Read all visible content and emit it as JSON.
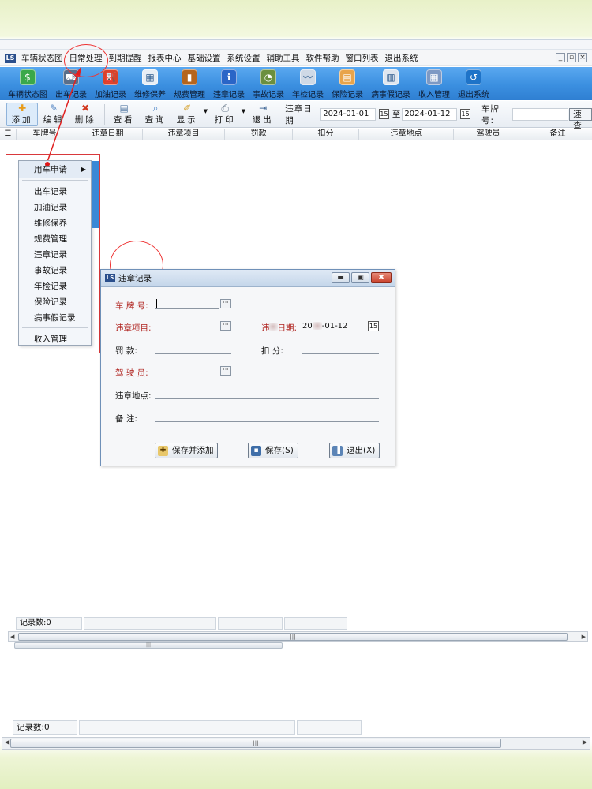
{
  "menubar": {
    "items": [
      "车辆状态图",
      "日常处理",
      "到期提醒",
      "报表中心",
      "基础设置",
      "系统设置",
      "辅助工具",
      "软件帮助",
      "窗口列表",
      "退出系统"
    ],
    "window_buttons": [
      "_",
      "▫",
      "×"
    ]
  },
  "toolbar_main": {
    "items": [
      {
        "label": "车辆状态图",
        "icon": "vehicle-status-icon",
        "color": "#3aa84a"
      },
      {
        "label": "出车记录",
        "icon": "dispatch-icon",
        "color": "#5a6f8a"
      },
      {
        "label": "加油记录",
        "icon": "fuel-icon",
        "color": "#d9422b"
      },
      {
        "label": "维修保养",
        "icon": "repair-icon",
        "color": "#e8eef5"
      },
      {
        "label": "规费管理",
        "icon": "fee-icon",
        "color": "#b5651d"
      },
      {
        "label": "违章记录",
        "icon": "violation-icon",
        "color": "#2a65c7"
      },
      {
        "label": "事故记录",
        "icon": "accident-icon",
        "color": "#6b8f3e"
      },
      {
        "label": "年检记录",
        "icon": "inspection-icon",
        "color": "#cfd9e6"
      },
      {
        "label": "保险记录",
        "icon": "insurance-icon",
        "color": "#e8a44a"
      },
      {
        "label": "病事假记录",
        "icon": "leave-icon",
        "color": "#dfe6ef"
      },
      {
        "label": "收入管理",
        "icon": "income-icon",
        "color": "#7d99c4"
      },
      {
        "label": "退出系统",
        "icon": "exit-icon",
        "color": "#1e73c8"
      }
    ]
  },
  "toolbar_sub": {
    "add": "添加",
    "edit": "编辑",
    "delete": "删除",
    "view": "查看",
    "query": "查询",
    "display": "显示",
    "print": "打印",
    "exit": "退出",
    "violation_date_label": "违章日期",
    "date_from": "2024-01-01",
    "to_label": "至",
    "date_to": "2024-01-12",
    "plate_label": "车牌号:",
    "fast_search": "速查"
  },
  "grid": {
    "columns": [
      "车牌号",
      "违章日期",
      "违章项目",
      "罚款",
      "扣分",
      "违章地点",
      "驾驶员",
      "备注"
    ]
  },
  "status": {
    "record_count": "记录数:0"
  },
  "context_menu": {
    "items": [
      "用车申请",
      "出车记录",
      "加油记录",
      "维修保养",
      "规费管理",
      "违章记录",
      "事故记录",
      "年检记录",
      "保险记录",
      "病事假记录",
      "收入管理"
    ]
  },
  "dialog": {
    "title": "违章记录",
    "plate_label": "车 牌 号:",
    "item_label": "违章项目:",
    "date_label_start": "违",
    "date_label_end": "日期:",
    "date_value_start": "20",
    "date_value_end": "-01-12",
    "fine_label": "罚      款:",
    "points_label": "扣      分:",
    "driver_label": "驾 驶 员:",
    "location_label": "违章地点:",
    "remark_label": "备      注:",
    "btn_save_add": "保存并添加",
    "btn_save": "保存(S)",
    "btn_exit": "退出(X)"
  },
  "bottom_status": {
    "record_count": "记录数:0"
  },
  "colors": {
    "toolbar_blue": "#3b8fe0",
    "annotation_red": "#e33333",
    "required_red": "#b0231f"
  }
}
